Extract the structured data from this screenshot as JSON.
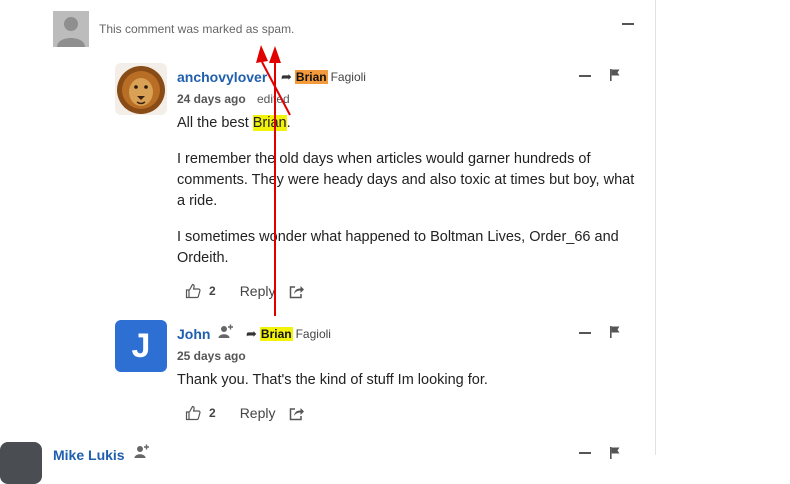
{
  "spam": {
    "text": "This comment was marked as spam."
  },
  "comments": [
    {
      "author": "anchovylover",
      "reply_to_highlight": "Brian",
      "reply_to_rest": "Fagioli",
      "date": "24 days ago",
      "edited": "edited",
      "body_p1_pre": "All the best ",
      "body_p1_hl": "Brian",
      "body_p1_post": ".",
      "body_p2": "I remember the old days when articles would garner hundreds of comments. They were heady days and also toxic at times but boy, what a ride.",
      "body_p3": "I sometimes wonder what happened to Boltman Lives, Order_66 and Ordeith.",
      "likes": "2",
      "reply_label": "Reply"
    },
    {
      "author": "John",
      "avatar_letter": "J",
      "reply_to_highlight": "Brian",
      "reply_to_rest": "Fagioli",
      "date": "25 days ago",
      "body": "Thank you. That's the kind of stuff Im looking for.",
      "likes": "2",
      "reply_label": "Reply"
    },
    {
      "author": "Mike Lukis"
    }
  ],
  "colors": {
    "link": "#1f5fae",
    "highlight": "#f2f20a",
    "annotation": "#e00000"
  }
}
